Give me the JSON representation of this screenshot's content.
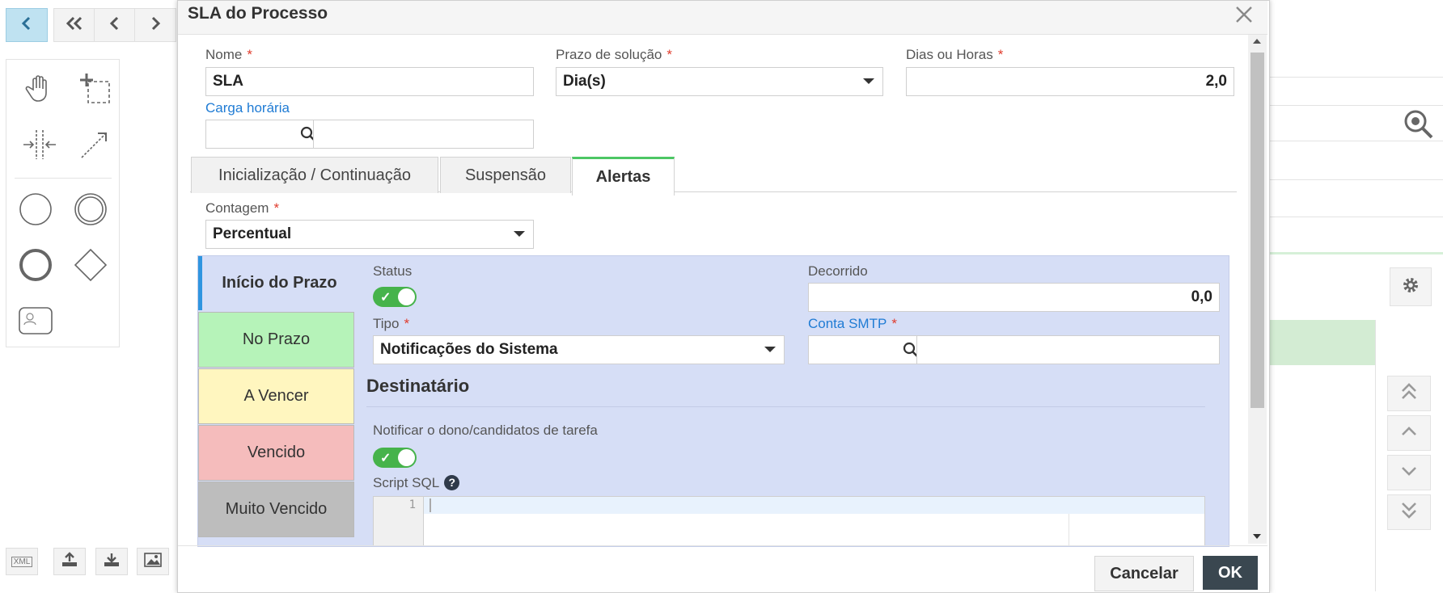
{
  "colors": {
    "accent_green": "#4cc764",
    "link_blue": "#1f7bd4",
    "required_red": "#e03b2c",
    "panel_blue": "#d6def6",
    "no_prazo": "#b6f3b9",
    "a_vencer": "#fff6bf",
    "vencido": "#f5bcbc",
    "muito_vencido": "#bdbdbd",
    "ok_button": "#3a4750"
  },
  "background": {
    "toolbar_icons": [
      "chevron-left-icon",
      "double-chevron-left-icon",
      "chevron-left-icon",
      "chevron-right-icon"
    ],
    "palette_icons": [
      "hand-tool-icon",
      "lasso-select-icon",
      "space-tool-icon",
      "connect-arrow-icon",
      "start-event-icon",
      "intermediate-event-icon",
      "end-event-icon",
      "gateway-icon",
      "user-task-icon"
    ],
    "bottom_tools": {
      "xml_label": "XML",
      "icons": [
        "upload-icon",
        "download-icon",
        "image-icon"
      ]
    },
    "right_icons": [
      "zoom-icon",
      "gear-icon"
    ],
    "nav_icons": [
      "double-chevron-up-icon",
      "chevron-up-icon",
      "chevron-down-icon",
      "double-chevron-down-icon"
    ]
  },
  "dialog": {
    "title": "SLA do Processo",
    "close_icon": "close-icon",
    "fields": {
      "nome": {
        "label": "Nome",
        "required_mark": "*",
        "value": "SLA"
      },
      "prazo": {
        "label": "Prazo de solução",
        "required_mark": "*",
        "value": "Dia(s)"
      },
      "dias_horas": {
        "label": "Dias ou Horas",
        "required_mark": "*",
        "value": "2,0"
      },
      "carga_horaria": {
        "label": "Carga horária",
        "code_value": "",
        "desc_value": ""
      }
    },
    "tabs": [
      {
        "label": "Inicialização / Continuação"
      },
      {
        "label": "Suspensão"
      },
      {
        "label": "Alertas"
      }
    ],
    "contagem": {
      "label": "Contagem",
      "required_mark": "*",
      "value": "Percentual"
    },
    "alert_sections": [
      {
        "label": "Início do Prazo"
      },
      {
        "label": "No Prazo"
      },
      {
        "label": "A Vencer"
      },
      {
        "label": "Vencido"
      },
      {
        "label": "Muito Vencido"
      }
    ],
    "alert_form": {
      "status_label": "Status",
      "status_on": true,
      "decorrido_label": "Decorrido",
      "decorrido_value": "0,0",
      "tipo_label": "Tipo",
      "tipo_required": "*",
      "tipo_value": "Notificações do Sistema",
      "conta_smtp_label": "Conta SMTP",
      "conta_smtp_required": "*",
      "destinatario_heading": "Destinatário",
      "notificar_label": "Notificar o dono/candidatos de tarefa",
      "notificar_on": true,
      "script_sql_label": "Script SQL",
      "help_icon": "?",
      "editor_line": "1"
    },
    "buttons": {
      "cancel": "Cancelar",
      "ok": "OK"
    }
  }
}
